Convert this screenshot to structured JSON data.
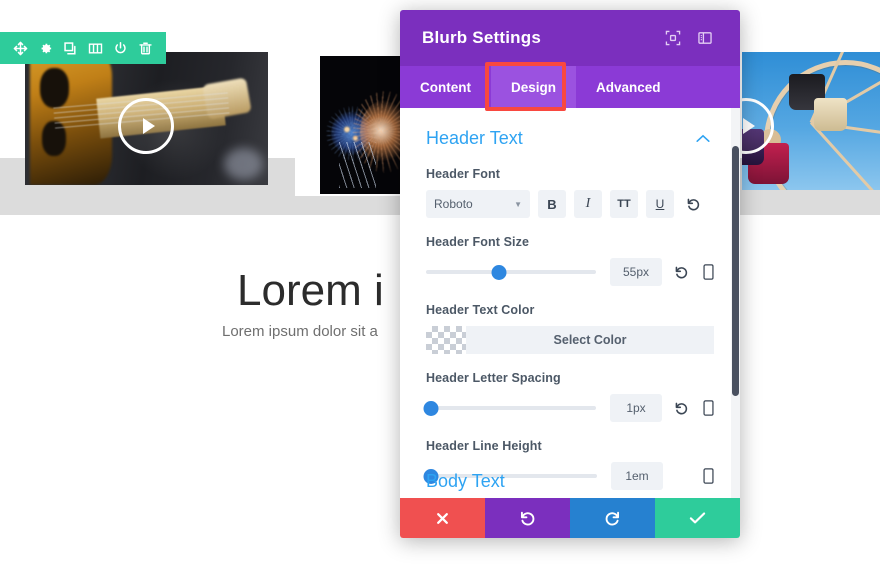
{
  "background_page": {
    "module_toolbar": {
      "name": "divi-module-toolbar",
      "color": "#2ecc9b",
      "icons": [
        "move-icon",
        "gear-icon",
        "duplicate-icon",
        "columns-icon",
        "power-icon",
        "trash-icon"
      ]
    },
    "media": [
      {
        "name": "guitar-video-thumbnail",
        "play_button": true
      },
      {
        "name": "fireworks-image",
        "play_button": false
      },
      {
        "name": "ferris-wheel-video-thumbnail",
        "play_button": true
      }
    ],
    "heading": "Lorem i",
    "subtext": "Lorem ipsum dolor sit a"
  },
  "modal": {
    "title": "Blurb Settings",
    "titlebar_color": "#7b2fbe",
    "header_icons": [
      {
        "name": "expand-icon",
        "label": "Expand"
      },
      {
        "name": "layout-panel-icon",
        "label": "Panel Layout"
      }
    ],
    "tabs": [
      {
        "label": "Content",
        "active": false
      },
      {
        "label": "Design",
        "active": true
      },
      {
        "label": "Advanced",
        "active": false
      }
    ],
    "tab_highlight_color": "#f9483f",
    "sections": {
      "header_text": {
        "title": "Header Text",
        "collapse_icon": "chevron-up-icon",
        "accent_color": "#2ea3f2",
        "fields": [
          {
            "label": "Header Font",
            "type": "font",
            "value": "Roboto",
            "style_buttons": [
              "B",
              "I",
              "TT",
              "U"
            ],
            "reset": true
          },
          {
            "label": "Header Font Size",
            "type": "slider",
            "value": "55px",
            "knob_percent": 43,
            "reset": true,
            "responsive": true
          },
          {
            "label": "Header Text Color",
            "type": "color",
            "button_label": "Select Color",
            "swatch": "transparent"
          },
          {
            "label": "Header Letter Spacing",
            "type": "slider",
            "value": "1px",
            "knob_percent": 2,
            "reset": true,
            "responsive": true
          },
          {
            "label": "Header Line Height",
            "type": "slider",
            "value": "1em",
            "knob_percent": 2,
            "reset": false,
            "responsive": true
          }
        ]
      },
      "next_section_title": "Body Text"
    },
    "footer": [
      {
        "name": "cancel-button",
        "icon": "close-icon",
        "color": "#f05050"
      },
      {
        "name": "undo-button",
        "icon": "undo-icon",
        "color": "#7b2fbe"
      },
      {
        "name": "redo-button",
        "icon": "redo-icon",
        "color": "#2681d0"
      },
      {
        "name": "save-button",
        "icon": "check-icon",
        "color": "#2ecc9b"
      }
    ]
  }
}
